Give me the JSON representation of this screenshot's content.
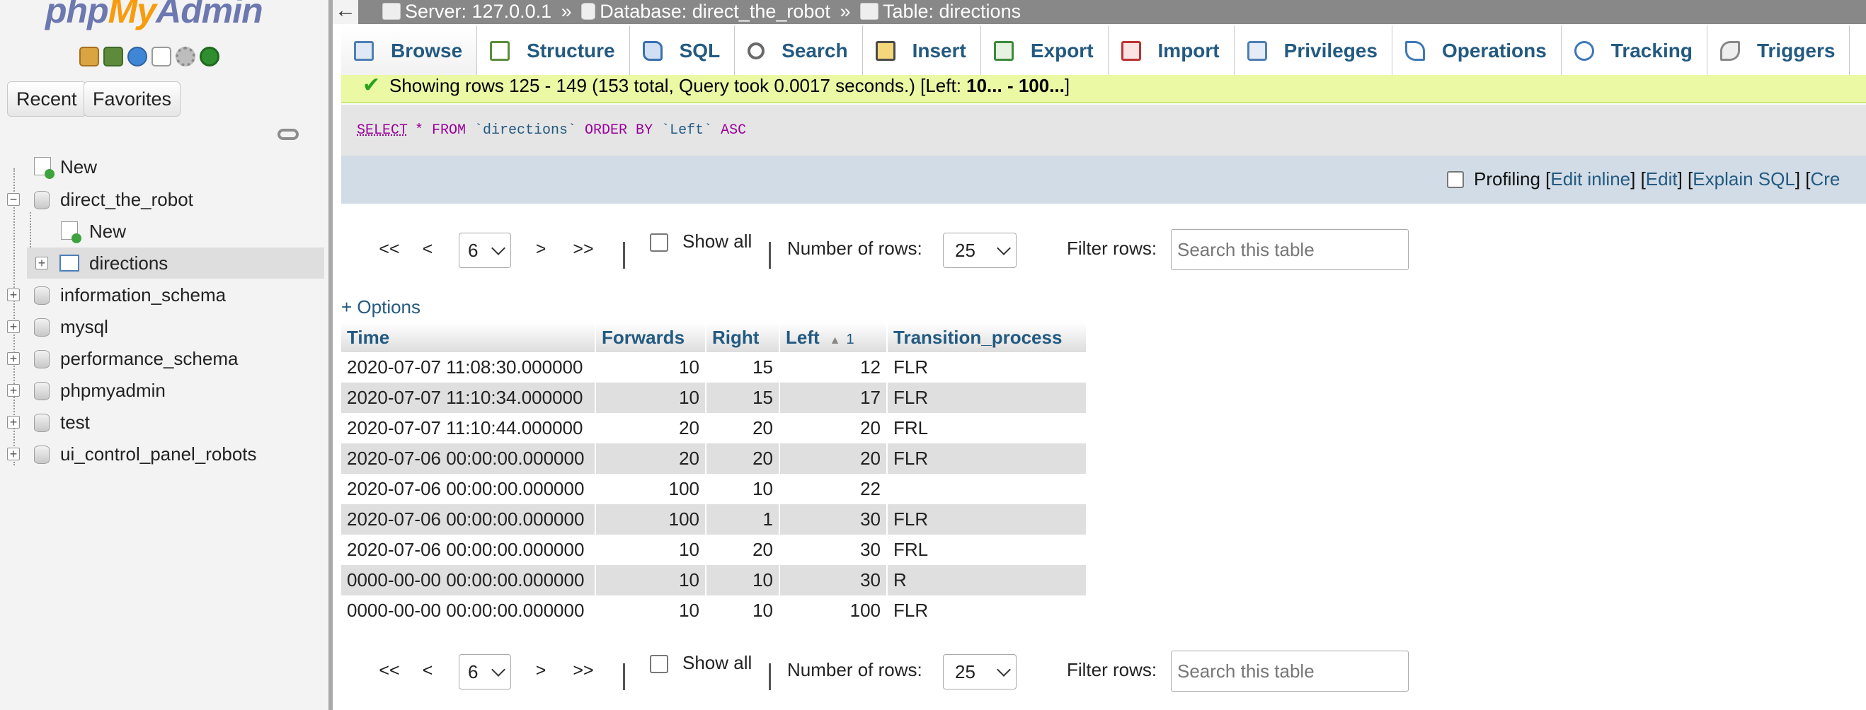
{
  "nav": {
    "logo_php": "php",
    "logo_my": "My",
    "logo_admin": "Admin",
    "icons": [
      "home-icon",
      "logout-icon",
      "help-icon",
      "docs-icon",
      "settings-icon",
      "reload-icon"
    ],
    "recent_label": "Recent",
    "favorites_label": "Favorites",
    "tree": [
      {
        "label": "New",
        "kind": "new"
      },
      {
        "label": "direct_the_robot",
        "kind": "db",
        "expanded": true
      },
      {
        "label": "New",
        "kind": "new"
      },
      {
        "label": "directions",
        "kind": "table",
        "selected": true
      },
      {
        "label": "information_schema",
        "kind": "db"
      },
      {
        "label": "mysql",
        "kind": "db"
      },
      {
        "label": "performance_schema",
        "kind": "db"
      },
      {
        "label": "phpmyadmin",
        "kind": "db"
      },
      {
        "label": "test",
        "kind": "db"
      },
      {
        "label": "ui_control_panel_robots",
        "kind": "db"
      }
    ]
  },
  "breadcrumb": {
    "back": "←",
    "server": "Server: 127.0.0.1",
    "database": "Database: direct_the_robot",
    "table": "Table: directions",
    "sep": "»"
  },
  "tabs": [
    {
      "label": "Browse",
      "icon": "browse-icon",
      "active": true
    },
    {
      "label": "Structure",
      "icon": "structure-icon"
    },
    {
      "label": "SQL",
      "icon": "sql-icon"
    },
    {
      "label": "Search",
      "icon": "search-icon"
    },
    {
      "label": "Insert",
      "icon": "insert-icon"
    },
    {
      "label": "Export",
      "icon": "export-icon"
    },
    {
      "label": "Import",
      "icon": "import-icon"
    },
    {
      "label": "Privileges",
      "icon": "privileges-icon"
    },
    {
      "label": "Operations",
      "icon": "operations-icon"
    },
    {
      "label": "Tracking",
      "icon": "tracking-icon"
    },
    {
      "label": "Triggers",
      "icon": "triggers-icon"
    }
  ],
  "success": {
    "text": "Showing rows 125 - 149 (153 total, Query took 0.0017 seconds.) [Left: ",
    "range": "10... - 100...",
    "close": "]"
  },
  "sql": {
    "keyword": "SELECT",
    "rest_star": "* FROM ",
    "table": "`directions`",
    "rest_order": " ORDER BY ",
    "column": "`Left`",
    "rest_dir": " ASC"
  },
  "profiling": {
    "label": "Profiling [",
    "edit_inline": "Edit inline",
    "sep1": "] [",
    "edit": "Edit",
    "sep2": "] [",
    "explain": "Explain SQL",
    "sep3": "] [",
    "create": "Cre"
  },
  "pager": {
    "first": "<<",
    "prev": "<",
    "page": "6",
    "next": ">",
    "last": ">>",
    "show_all": "Show all",
    "rows_label": "Number of rows:",
    "rows_value": "25",
    "filter_label": "Filter rows:",
    "filter_placeholder": "Search this table"
  },
  "options_label": "+ Options",
  "table": {
    "columns": [
      "Time",
      "Forwards",
      "Right",
      "Left",
      "Transition_process"
    ],
    "sort_index": "1",
    "rows": [
      [
        "2020-07-07 11:08:30.000000",
        "10",
        "15",
        "12",
        "FLR"
      ],
      [
        "2020-07-07 11:10:34.000000",
        "10",
        "15",
        "17",
        "FLR"
      ],
      [
        "2020-07-07 11:10:44.000000",
        "20",
        "20",
        "20",
        "FRL"
      ],
      [
        "2020-07-06 00:00:00.000000",
        "20",
        "20",
        "20",
        "FLR"
      ],
      [
        "2020-07-06 00:00:00.000000",
        "100",
        "10",
        "22",
        ""
      ],
      [
        "2020-07-06 00:00:00.000000",
        "100",
        "1",
        "30",
        "FLR"
      ],
      [
        "2020-07-06 00:00:00.000000",
        "10",
        "20",
        "30",
        "FRL"
      ],
      [
        "0000-00-00 00:00:00.000000",
        "10",
        "10",
        "30",
        "R"
      ],
      [
        "0000-00-00 00:00:00.000000",
        "10",
        "10",
        "100",
        "FLR"
      ]
    ]
  }
}
